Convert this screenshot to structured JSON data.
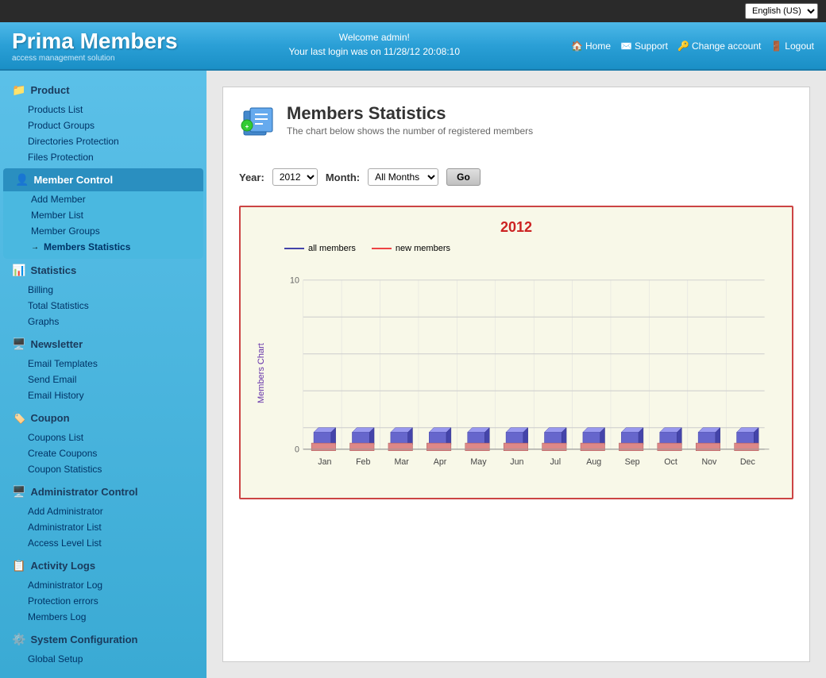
{
  "topbar": {
    "lang_value": "English (US)"
  },
  "header": {
    "logo_title": "Prima Members",
    "logo_sub": "access management solution",
    "welcome": "Welcome admin!",
    "last_login": "Your last login was on 11/28/12 20:08:10",
    "links": {
      "home": "Home",
      "support": "Support",
      "change_account": "Change account",
      "logout": "Logout"
    }
  },
  "sidebar": {
    "sections": [
      {
        "id": "product",
        "label": "Product",
        "icon": "📁",
        "active": false,
        "items": [
          {
            "id": "products-list",
            "label": "Products List",
            "active": false
          },
          {
            "id": "product-groups",
            "label": "Product Groups",
            "active": false
          },
          {
            "id": "directories-protection",
            "label": "Directories Protection",
            "active": false
          },
          {
            "id": "files-protection",
            "label": "Files Protection",
            "active": false
          }
        ]
      },
      {
        "id": "member-control",
        "label": "Member Control",
        "icon": "👤",
        "active": true,
        "items": [
          {
            "id": "add-member",
            "label": "Add Member",
            "active": false
          },
          {
            "id": "member-list",
            "label": "Member List",
            "active": false
          },
          {
            "id": "member-groups",
            "label": "Member Groups",
            "active": false
          },
          {
            "id": "members-statistics",
            "label": "Members Statistics",
            "active": true
          }
        ]
      },
      {
        "id": "statistics",
        "label": "Statistics",
        "icon": "📊",
        "active": false,
        "items": [
          {
            "id": "billing",
            "label": "Billing",
            "active": false
          },
          {
            "id": "total-statistics",
            "label": "Total Statistics",
            "active": false
          },
          {
            "id": "graphs",
            "label": "Graphs",
            "active": false
          }
        ]
      },
      {
        "id": "newsletter",
        "label": "Newsletter",
        "icon": "🖥️",
        "active": false,
        "items": [
          {
            "id": "email-templates",
            "label": "Email Templates",
            "active": false
          },
          {
            "id": "send-email",
            "label": "Send Email",
            "active": false
          },
          {
            "id": "email-history",
            "label": "Email History",
            "active": false
          }
        ]
      },
      {
        "id": "coupon",
        "label": "Coupon",
        "icon": "🏷️",
        "active": false,
        "items": [
          {
            "id": "coupons-list",
            "label": "Coupons List",
            "active": false
          },
          {
            "id": "create-coupons",
            "label": "Create Coupons",
            "active": false
          },
          {
            "id": "coupon-statistics",
            "label": "Coupon Statistics",
            "active": false
          }
        ]
      },
      {
        "id": "administrator-control",
        "label": "Administrator Control",
        "icon": "🖥️",
        "active": false,
        "items": [
          {
            "id": "add-administrator",
            "label": "Add Administrator",
            "active": false
          },
          {
            "id": "administrator-list",
            "label": "Administrator List",
            "active": false
          },
          {
            "id": "access-level-list",
            "label": "Access Level List",
            "active": false
          }
        ]
      },
      {
        "id": "activity-logs",
        "label": "Activity Logs",
        "icon": "📋",
        "active": false,
        "items": [
          {
            "id": "administrator-log",
            "label": "Administrator Log",
            "active": false
          },
          {
            "id": "protection-errors",
            "label": "Protection errors",
            "active": false
          },
          {
            "id": "members-log",
            "label": "Members Log",
            "active": false
          }
        ]
      },
      {
        "id": "system-configuration",
        "label": "System Configuration",
        "icon": "⚙️",
        "active": false,
        "items": [
          {
            "id": "global-setup",
            "label": "Global Setup",
            "active": false
          }
        ]
      }
    ]
  },
  "content": {
    "page_icon": "📊",
    "page_title": "Members Statistics",
    "page_subtitle": "The chart below shows the number of registered members",
    "filter": {
      "year_label": "Year:",
      "year_value": "2012",
      "month_label": "Month:",
      "month_value": "All Months",
      "go_label": "Go"
    },
    "chart": {
      "title": "2012",
      "legend": {
        "all_members": "all members",
        "new_members": "new members"
      },
      "y_axis_label": "Members Chart",
      "y_max": 10,
      "y_min": 0,
      "months": [
        "Jan",
        "Feb",
        "Mar",
        "Apr",
        "May",
        "Jun",
        "Jul",
        "Aug",
        "Sep",
        "Oct",
        "Nov",
        "Dec"
      ],
      "all_members_data": [
        1,
        1,
        1,
        1,
        1,
        1,
        1,
        1,
        1,
        1,
        1,
        1
      ],
      "new_members_data": [
        1,
        1,
        1,
        1,
        1,
        1,
        1,
        1,
        1,
        1,
        1,
        1
      ]
    }
  }
}
